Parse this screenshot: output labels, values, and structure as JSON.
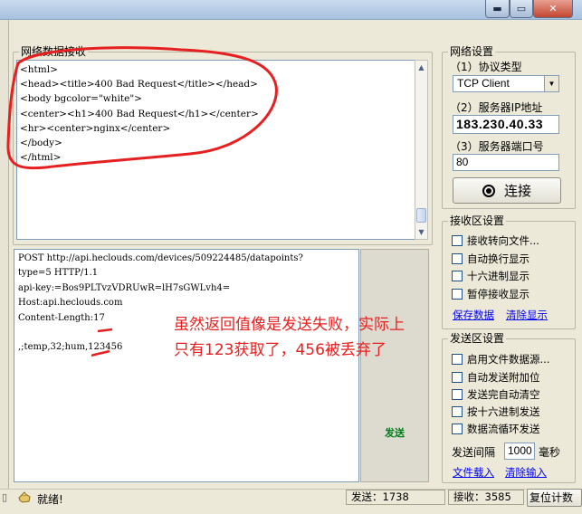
{
  "window": {
    "min_glyph": "▬",
    "max_glyph": "▭",
    "close_glyph": "✕"
  },
  "receive": {
    "legend": "网络数据接收",
    "lines": [
      "<html>",
      "<head><title>400 Bad Request</title></head>",
      "<body bgcolor=\"white\">",
      "<center><h1>400 Bad Request</h1></center>",
      "<hr><center>nginx</center>",
      "</body>",
      "</html>"
    ]
  },
  "send": {
    "lines": [
      "POST http://api.heclouds.com/devices/509224485/datapoints?",
      "type=5 HTTP/1.1",
      "api-key:=Bos9PLTvzVDRUwR=lH7sGWLvh4=",
      "Host:api.heclouds.com",
      "Content-Length:17",
      "",
      ",;temp,32;hum,123456"
    ],
    "button_label": "发送"
  },
  "annotation": {
    "line1": "虽然返回值像是发送失败，实际上",
    "line2": "只有123获取了，456被丢弃了"
  },
  "network_settings": {
    "legend": "网络设置",
    "protocol_label": "（1）协议类型",
    "protocol_value": "TCP Client",
    "ip_label": "（2）服务器IP地址",
    "ip_value": "183.230.40.33",
    "port_label": "（3）服务器端口号",
    "port_value": "80",
    "connect_label": "连接"
  },
  "receive_settings": {
    "legend": "接收区设置",
    "options": [
      "接收转向文件...",
      "自动换行显示",
      "十六进制显示",
      "暂停接收显示"
    ],
    "save_link": "保存数据",
    "clear_link": "清除显示"
  },
  "send_settings": {
    "legend": "发送区设置",
    "options": [
      "启用文件数据源...",
      "自动发送附加位",
      "发送完自动清空",
      "按十六进制发送",
      "数据流循环发送"
    ],
    "interval_label": "发送间隔",
    "interval_value": "1000",
    "interval_unit": "毫秒",
    "load_link": "文件载入",
    "clear_link": "清除输入"
  },
  "status": {
    "ready": "就绪!",
    "sent": "发送：1738",
    "received": "接收：3585",
    "reset": "复位计数"
  },
  "colors": {
    "annotation_red": "#e62020",
    "send_button_green": "#007a1a"
  }
}
